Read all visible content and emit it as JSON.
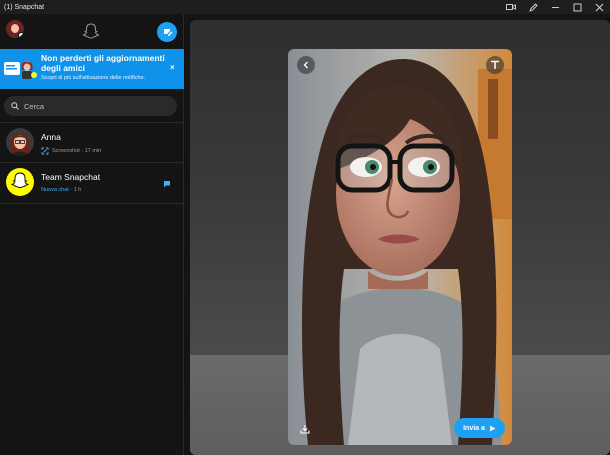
{
  "window": {
    "title": "(1) Snapchat"
  },
  "banner": {
    "title": "Non perderti gli aggiornamenti degli amici",
    "subtitle": "Scopri di più sull'attivazione delle notifiche.",
    "close": "×"
  },
  "search": {
    "placeholder": "Cerca"
  },
  "chats": [
    {
      "name": "Anna",
      "status": "Screenshot",
      "time": "· 17 min"
    },
    {
      "name": "Team Snapchat",
      "status": "Nuova chat",
      "time": "· 1 h"
    }
  ],
  "preview": {
    "send_label": "Invia a"
  },
  "icons": [
    "ghost-icon",
    "new-chat-icon",
    "search-icon",
    "screenshot-icon",
    "chat-bubble-icon",
    "back-icon",
    "text-tool-icon",
    "download-icon",
    "send-arrow-icon"
  ],
  "colors": {
    "accent": "#1ea1f2",
    "banner": "#0f92ea",
    "snap_yellow": "#fffc00",
    "background": "#141414"
  }
}
